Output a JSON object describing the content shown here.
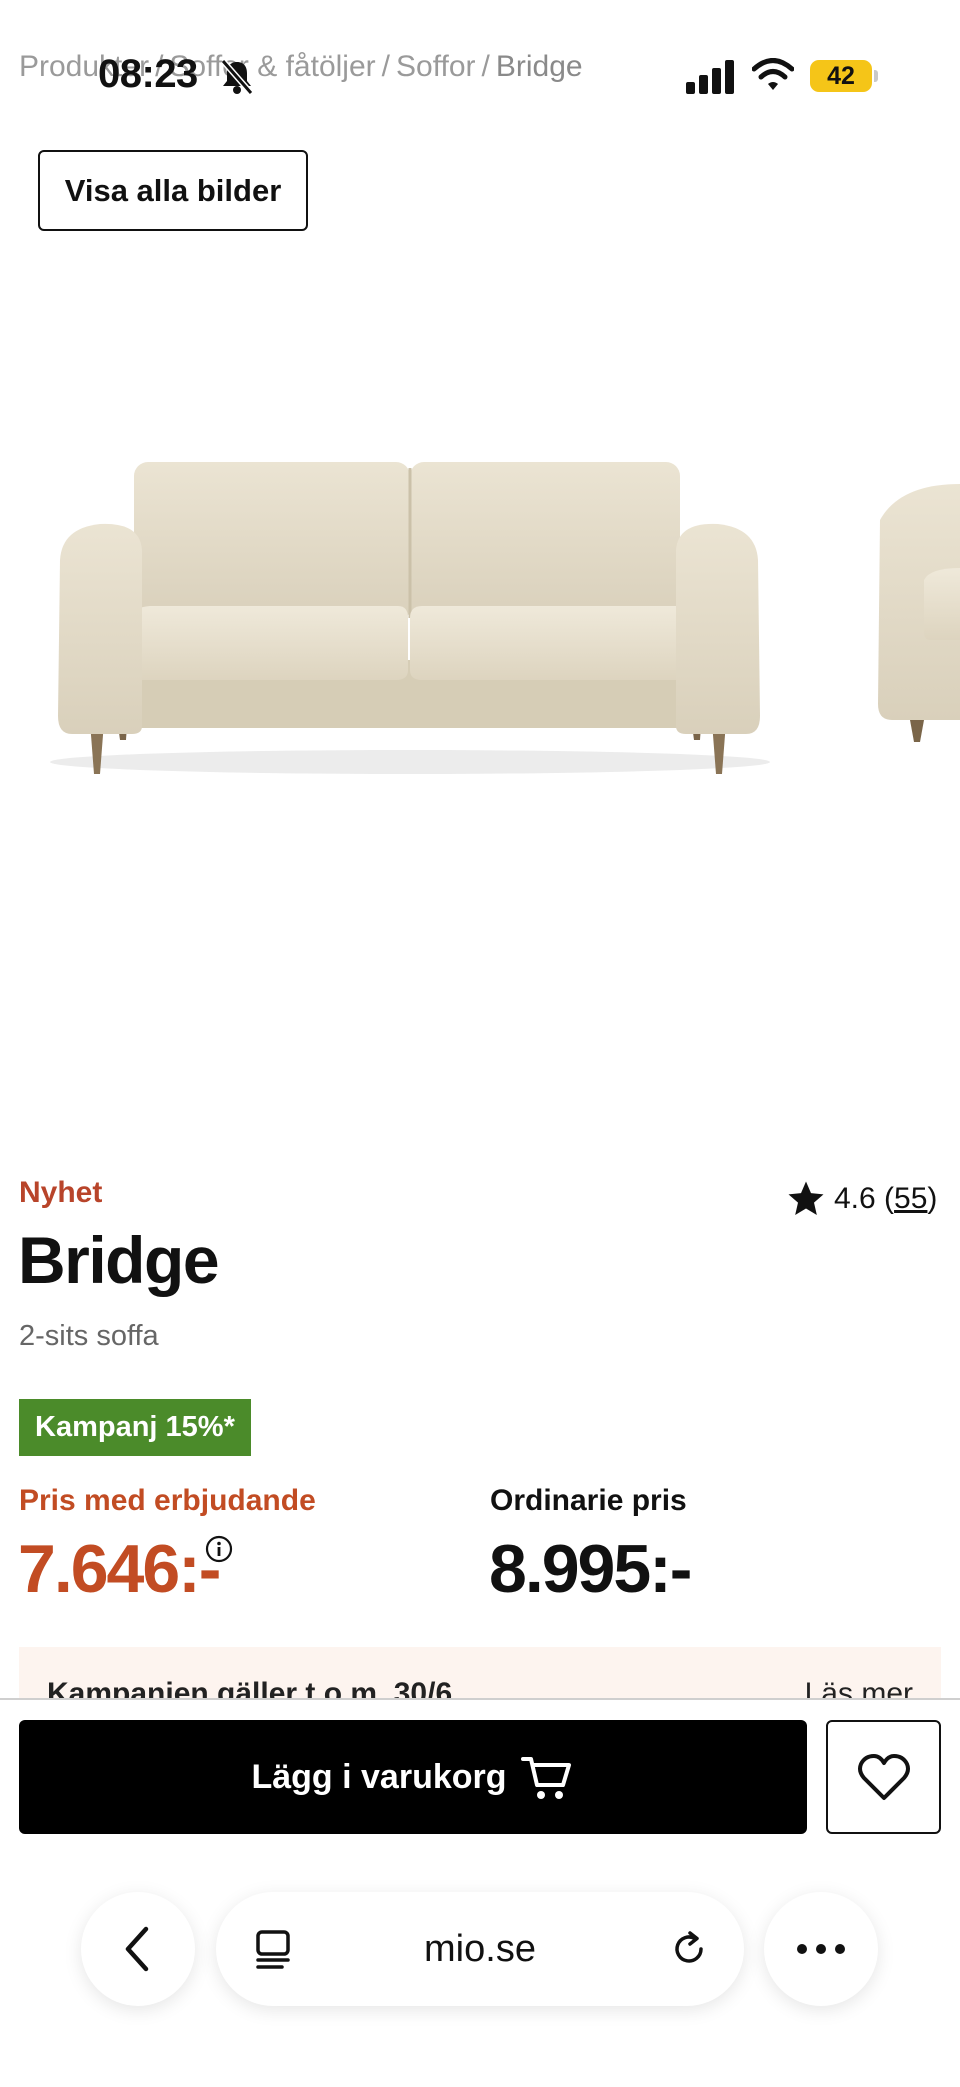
{
  "status_bar": {
    "time": "08:23",
    "battery": "42"
  },
  "breadcrumb": {
    "items": [
      "Produkter",
      "Soffor & fåtöljer",
      "Soffor",
      "Bridge"
    ],
    "separator": "/"
  },
  "gallery": {
    "show_all_label": "Visa alla bilder"
  },
  "product": {
    "tag": "Nyhet",
    "rating": "4.6",
    "review_count": "55",
    "title": "Bridge",
    "subtitle": "2-sits soffa",
    "campaign_badge": "Kampanj 15%*",
    "offer_label": "Pris med erbjudande",
    "offer_price": "7.646:-",
    "regular_label": "Ordinarie pris",
    "regular_price": "8.995:-"
  },
  "notice": {
    "text": "Kampanjen gäller t.o.m. 30/6",
    "link": "Läs mer"
  },
  "actions": {
    "add_to_cart_label": "Lägg i varukorg"
  },
  "browser": {
    "url": "mio.se"
  },
  "icons": {
    "bell": "bell-slash-icon",
    "signal": "cellular-signal-icon",
    "wifi": "wifi-icon",
    "star": "star-icon",
    "info": "info-icon",
    "cart": "cart-icon",
    "heart": "heart-icon",
    "back": "chevron-left-icon",
    "tabs": "tabs-icon",
    "reload": "reload-icon",
    "more": "more-icon"
  },
  "colors": {
    "accent_red": "#c24c23",
    "campaign_green": "#4b8b2a",
    "battery_yellow": "#f5c518",
    "notice_bg": "#fdf4ef"
  }
}
